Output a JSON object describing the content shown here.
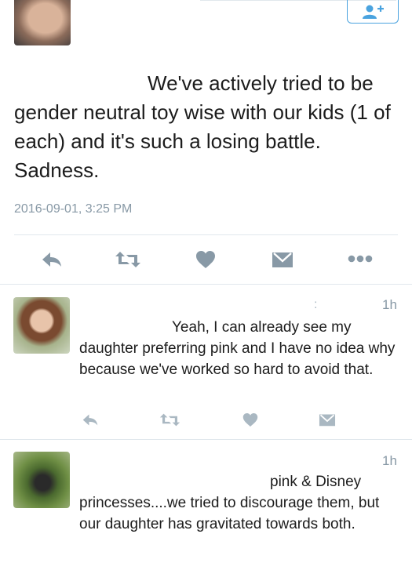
{
  "tweet": {
    "text_line1": "We've actively tried to be",
    "text_rest": "gender neutral toy wise with our kids (1 of each) and it's such a losing battle. Sadness.",
    "timestamp": "2016-09-01, 3:25 PM"
  },
  "icons": {
    "follow": "add-user-icon",
    "reply": "reply-icon",
    "retweet": "retweet-icon",
    "like": "heart-icon",
    "dm": "envelope-icon",
    "more": "more-icon"
  },
  "colors": {
    "icon": "#8899a6",
    "accent": "#4aa3df",
    "divider": "#e1e8ed"
  },
  "replies": [
    {
      "time": "1h",
      "marker": ":",
      "text_line1": "Yeah, I can already see my",
      "text_rest": "daughter preferring pink and I have no idea why because we've worked so hard to avoid that."
    },
    {
      "time": "1h",
      "text_line1": "pink & Disney",
      "text_rest": "princesses....we tried to discourage them, but our daughter has gravitated towards both."
    }
  ]
}
